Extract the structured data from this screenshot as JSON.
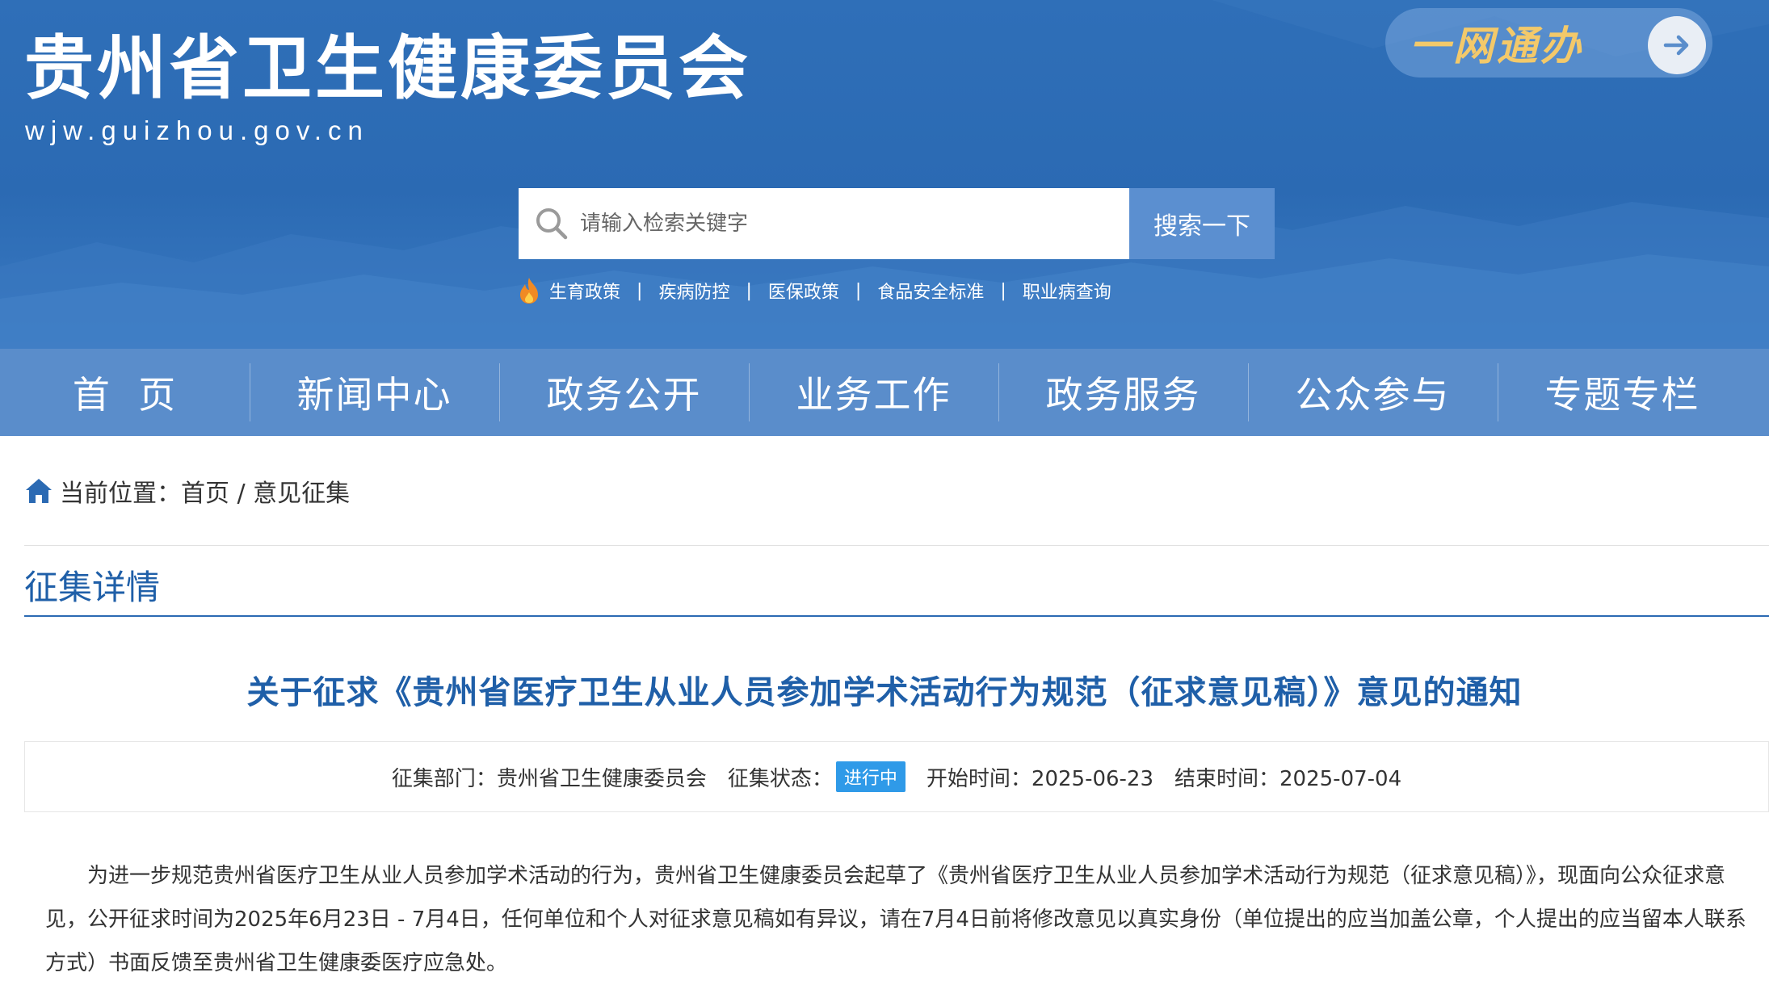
{
  "header": {
    "site_title": "贵州省卫生健康委员会",
    "site_domain": "wjw.guizhou.gov.cn",
    "portal_button": "一网通办",
    "search": {
      "placeholder": "请输入检索关键字",
      "button_label": "搜索一下"
    },
    "hot_links": [
      "生育政策",
      "疾病防控",
      "医保政策",
      "食品安全标准",
      "职业病查询"
    ],
    "hot_separator": "|"
  },
  "nav": {
    "items": [
      "首  页",
      "新闻中心",
      "政务公开",
      "业务工作",
      "政务服务",
      "公众参与",
      "专题专栏"
    ]
  },
  "breadcrumb": {
    "text": "当前位置：首页 / 意见征集"
  },
  "section": {
    "title": "征集详情"
  },
  "notice": {
    "title": "关于征求《贵州省医疗卫生从业人员参加学术活动行为规范（征求意见稿）》意见的通知",
    "meta": {
      "department": "征集部门：贵州省卫生健康委员会",
      "status_label": "征集状态：",
      "status_value": "进行中",
      "start": "开始时间：2025-06-23",
      "end": "结束时间：2025-07-04"
    },
    "body": "为进一步规范贵州省医疗卫生从业人员参加学术活动的行为，贵州省卫生健康委员会起草了《贵州省医疗卫生从业人员参加学术活动行为规范（征求意见稿）》，现面向公众征求意见，公开征求时间为2025年6月23日 - 7月4日，任何单位和个人对征求意见稿如有异议，请在7月4日前将修改意见以真实身份（单位提出的应当加盖公章，个人提出的应当留本人联系方式）书面反馈至贵州省卫生健康委医疗应急处。"
  },
  "colors": {
    "header_blue": "#2f6fb8",
    "nav_blue": "#5a8dcb",
    "title_blue": "#1f5fa8",
    "status_blue": "#2f9ae8",
    "portal_gold": "#f3c96a"
  },
  "icons": [
    "search-icon",
    "fire-icon",
    "arrow-right-icon",
    "home-icon"
  ]
}
